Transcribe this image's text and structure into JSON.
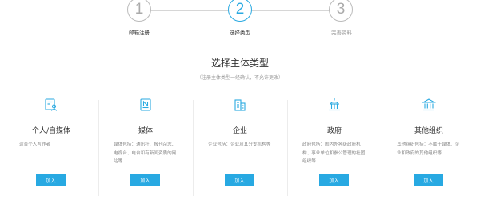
{
  "steps": [
    {
      "number": "1",
      "label": "邮箱注册"
    },
    {
      "number": "2",
      "label": "选择类型"
    },
    {
      "number": "3",
      "label": "完善资料"
    }
  ],
  "accent_color": "#29a9e1",
  "heading": {
    "title": "选择主体类型",
    "subtitle": "（注册主体类型一经确认，不允许更改）"
  },
  "cards": [
    {
      "name": "个人/自媒体",
      "description": "适合个人写作者",
      "button_label": "加入",
      "icon": "person-id-icon"
    },
    {
      "name": "媒体",
      "description": "媒体包括：通讯社、报刊杂志、电视台、电台和有新闻资质的网站等",
      "button_label": "加入",
      "icon": "newspaper-icon"
    },
    {
      "name": "企业",
      "description": "企业包括：企业及其分支机构等",
      "button_label": "加入",
      "icon": "building-icon"
    },
    {
      "name": "政府",
      "description": "政府包括：国内外各级政府机构、事业单位和参公管理的社团组织等",
      "button_label": "加入",
      "icon": "government-icon"
    },
    {
      "name": "其他组织",
      "description": "其他组织包括：不属于媒体、企业和政府的其他组织等",
      "button_label": "加入",
      "icon": "institution-icon"
    }
  ]
}
